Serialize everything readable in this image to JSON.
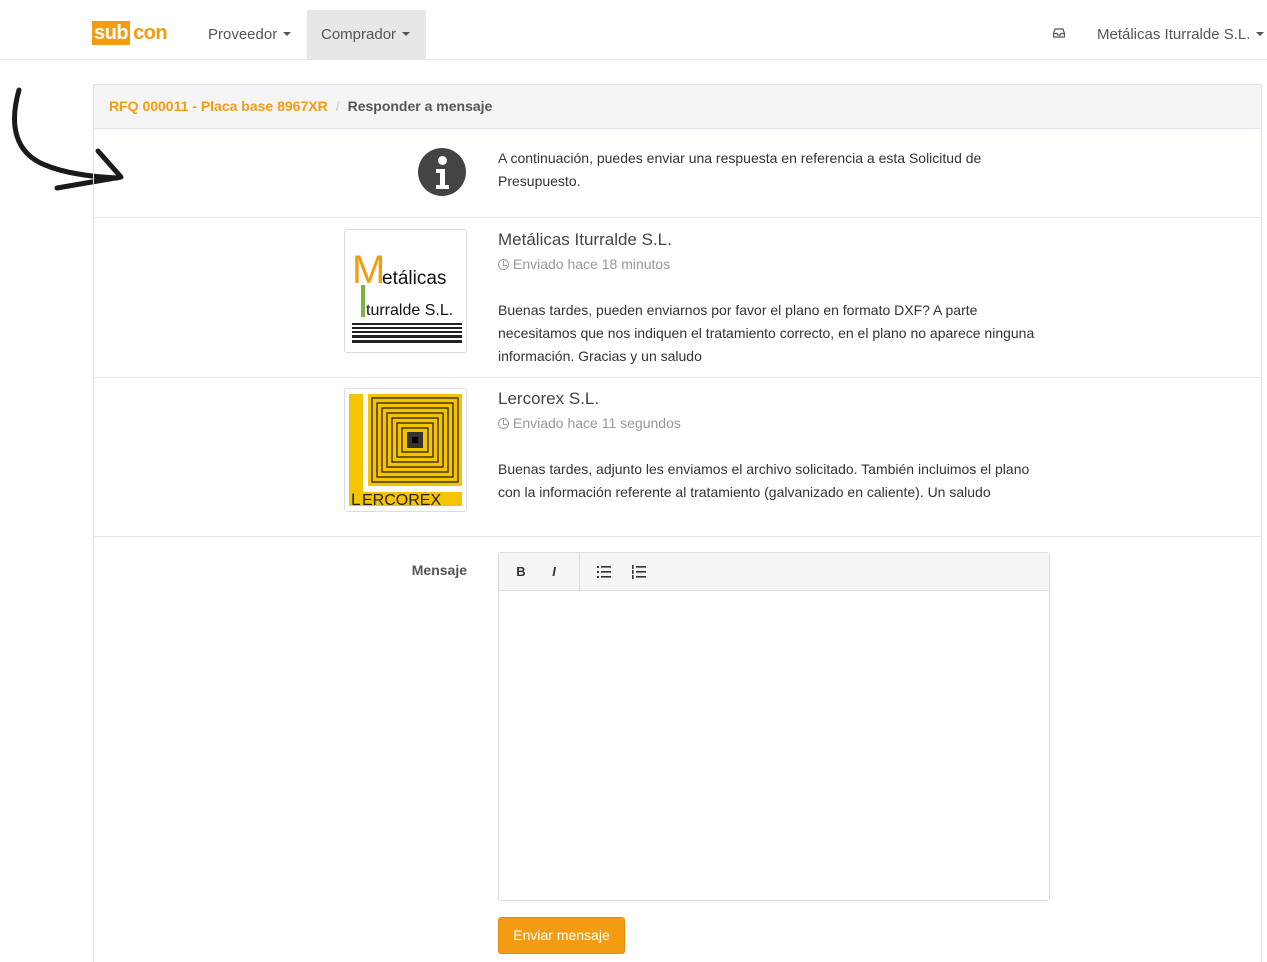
{
  "brand": {
    "logo_part1": "sub",
    "logo_part2": "con",
    "accent_color": "#f39c12"
  },
  "navbar": {
    "menu": [
      {
        "label": "Proveedor",
        "active": false
      },
      {
        "label": "Comprador",
        "active": true
      }
    ],
    "inbox_icon": "inbox-icon",
    "user_label": "Metálicas Iturralde S.L."
  },
  "breadcrumb": {
    "link": "RFQ 000011 - Placa base 8967XR",
    "separator": "/",
    "current": "Responder a mensaje"
  },
  "info": {
    "icon": "info-icon",
    "text": "A continuación, puedes enviar una respuesta en referencia a esta Solicitud de Presupuesto."
  },
  "messages": [
    {
      "sender": "Metálicas Iturralde S.L.",
      "time": "Enviado hace 18 minutos",
      "body": "Buenas tardes, pueden enviarnos por favor el plano en formato DXF? A parte necesitamos que nos indiquen el tratamiento correcto, en el plano no aparece ninguna información. Gracias y un saludo",
      "logo": {
        "letter1": "M",
        "text1": "etálicas",
        "letter2": "I",
        "text2": "turralde S.L."
      }
    },
    {
      "sender": "Lercorex S.L.",
      "time": "Enviado hace 11 segundos",
      "body": "Buenas tardes, adjunto les enviamos el archivo solicitado. También incluimos el plano con la información referente al tratamiento (galvanizado en caliente). Un saludo",
      "logo": {
        "letter": "L",
        "text": "ERCOREX"
      }
    }
  ],
  "form": {
    "label": "Mensaje",
    "toolbar": {
      "bold": "B",
      "italic": "I",
      "ul_icon": "bullet-list-icon",
      "ol_icon": "numbered-list-icon"
    },
    "message_value": "",
    "submit_label": "Enviar mensaje"
  }
}
